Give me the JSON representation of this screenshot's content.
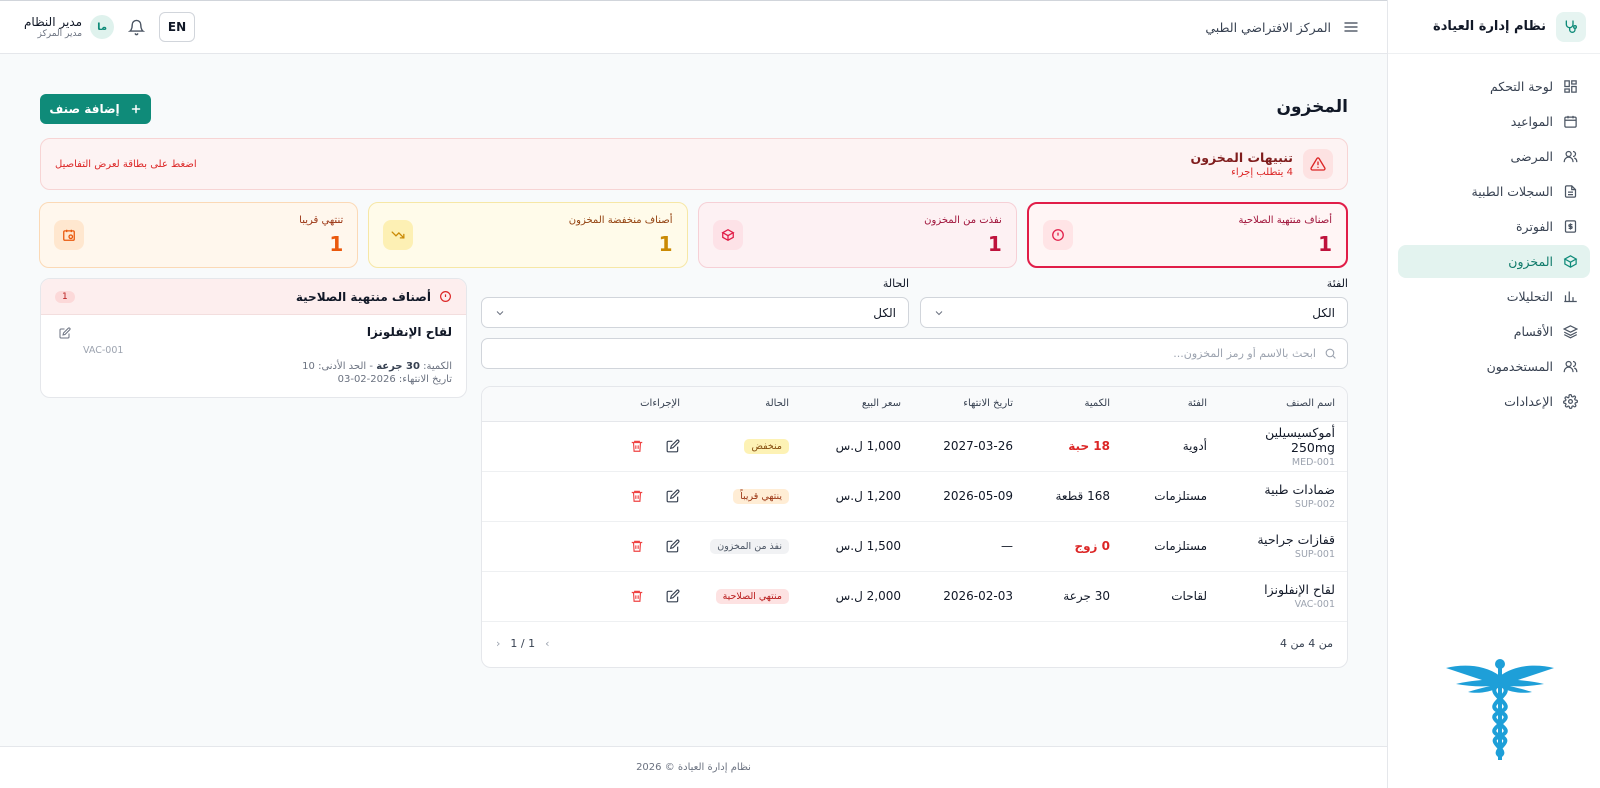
{
  "sidebar": {
    "brand": "نظام إدارة العيادة",
    "items": [
      {
        "label": "لوحة التحكم",
        "icon": "dashboard-icon"
      },
      {
        "label": "المواعيد",
        "icon": "calendar-icon"
      },
      {
        "label": "المرضى",
        "icon": "users-icon"
      },
      {
        "label": "السجلات الطبية",
        "icon": "file-icon"
      },
      {
        "label": "الفوترة",
        "icon": "dollar-icon"
      },
      {
        "label": "المخزون",
        "icon": "box-icon",
        "active": true
      },
      {
        "label": "التحليلات",
        "icon": "chart-icon"
      },
      {
        "label": "الأقسام",
        "icon": "layers-icon"
      },
      {
        "label": "المستخدمون",
        "icon": "users-icon"
      },
      {
        "label": "الإعدادات",
        "icon": "gear-icon"
      }
    ]
  },
  "header": {
    "center_name": "المركز الافتراضي الطبي",
    "lang": "EN",
    "user_name": "مدير النظام",
    "user_role": "مدير المركز",
    "avatar_initials": "ما"
  },
  "page": {
    "title": "المخزون",
    "add_button": "إضافة صنف"
  },
  "alert": {
    "title": "تنبيهات المخزون",
    "subtitle": "4 يتطلب إجراء",
    "hint": "اضغط على بطاقة لعرض التفاصيل"
  },
  "stats": [
    {
      "label": "أصناف منتهية الصلاحية",
      "value": "1"
    },
    {
      "label": "نفذت من المخزون",
      "value": "1"
    },
    {
      "label": "أصناف منخفضة المخزون",
      "value": "1"
    },
    {
      "label": "تنتهي قريبا",
      "value": "1"
    }
  ],
  "filters": {
    "category_label": "الفئة",
    "category_value": "الكل",
    "status_label": "الحالة",
    "status_value": "الكل",
    "search_placeholder": "ابحث بالاسم أو رمز المخزون..."
  },
  "table": {
    "headers": [
      "اسم الصنف",
      "الفئة",
      "الكمية",
      "تاريخ الانتهاء",
      "سعر البيع",
      "الحالة",
      "الإجراءات"
    ],
    "rows": [
      {
        "name": "أموكسيسيلين 250mg",
        "code": "MED-001",
        "category": "أدوية",
        "qty": "18 حبة",
        "expiry": "2027-03-26",
        "price": "1,000 ل.س",
        "status": "منخفض"
      },
      {
        "name": "ضمادات طبية",
        "code": "SUP-002",
        "category": "مستلزمات",
        "qty": "168 قطعة",
        "expiry": "2026-05-09",
        "price": "1,200 ل.س",
        "status": "ينتهي قريباً"
      },
      {
        "name": "قفازات جراحية",
        "code": "SUP-001",
        "category": "مستلزمات",
        "qty": "0 زوج",
        "expiry": "—",
        "price": "1,500 ل.س",
        "status": "نفذ من المخزون"
      },
      {
        "name": "لقاح الإنفلونزا",
        "code": "VAC-001",
        "category": "لقاحات",
        "qty": "30 جرعة",
        "expiry": "2026-02-03",
        "price": "2,000 ل.س",
        "status": "منتهي الصلاحية"
      }
    ],
    "pager_count": "من 4 من 4",
    "pager_pages": "1 / 1"
  },
  "expired_panel": {
    "title": "أصناف منتهية الصلاحية",
    "count": "1",
    "item_name": "لقاح الإنفلونزا",
    "item_code": "VAC-001",
    "qty_label": "الكمية:",
    "qty_value": "30 جرعة",
    "min_label": "- الحد الأدنى: 10",
    "expiry_line": "تاريخ الانتهاء: 2026-02-03"
  },
  "footer": {
    "text": "نظام إدارة العيادة © 2026"
  },
  "colors": {
    "accent": "#0f8b79",
    "danger": "#dc2626"
  }
}
